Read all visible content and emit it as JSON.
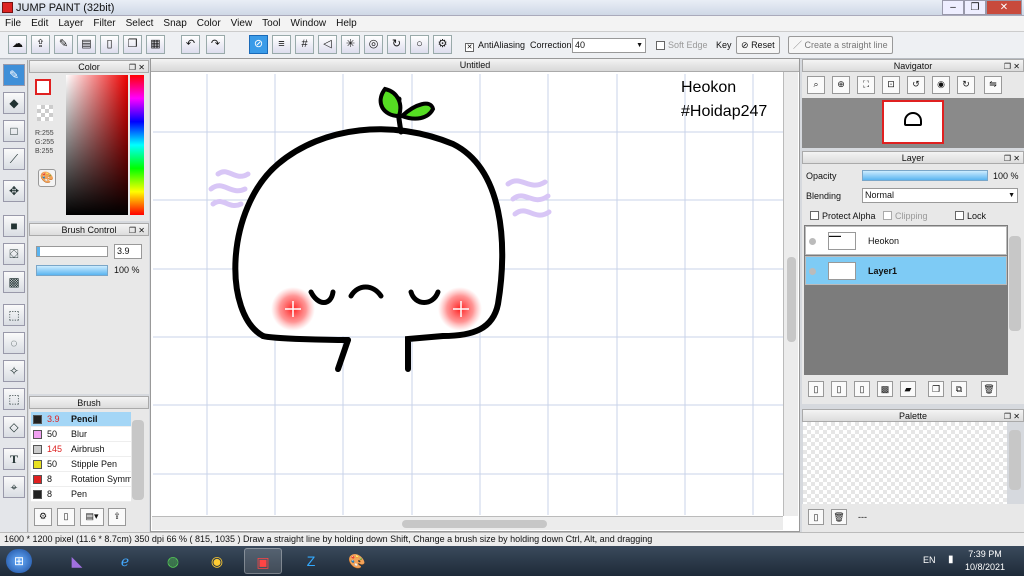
{
  "window": {
    "title": "JUMP PAINT (32bit)",
    "minimize": "–",
    "restore": "❐",
    "close": "✕"
  },
  "menu": [
    "File",
    "Edit",
    "Layer",
    "Filter",
    "Select",
    "Snap",
    "Color",
    "View",
    "Tool",
    "Window",
    "Help"
  ],
  "toolbar": {
    "antialiasing_label": "AntiAliasing",
    "correction_label": "Correction",
    "correction_value": "40",
    "soft_edge_label": "Soft Edge",
    "key_label": "Key",
    "reset_label": "Reset",
    "straight_line_label": "Create a straight line"
  },
  "color_panel": {
    "title": "Color",
    "r": "R:255",
    "g": "G:255",
    "b": "B:255",
    "fg_color": "#e02020"
  },
  "brush_control": {
    "title": "Brush Control",
    "size": "3.9",
    "opacity": "100 %"
  },
  "brush_panel": {
    "title": "Brush",
    "items": [
      {
        "size": "3.9",
        "name": "Pencil",
        "color": "#222222",
        "selected": true
      },
      {
        "size": "50",
        "name": "Blur",
        "color": "#f0a0f0"
      },
      {
        "size": "145",
        "name": "Airbrush",
        "color": "#cccccc"
      },
      {
        "size": "50",
        "name": "Stipple Pen",
        "color": "#e8e020"
      },
      {
        "size": "8",
        "name": "Rotation Symm",
        "color": "#e02020"
      },
      {
        "size": "8",
        "name": "Pen",
        "color": "#222222"
      }
    ]
  },
  "canvas": {
    "tab_title": "Untitled",
    "text_line1": "Heokon",
    "text_line2": "#Hoidap247"
  },
  "navigator": {
    "title": "Navigator"
  },
  "layer_panel": {
    "title": "Layer",
    "opacity_label": "Opacity",
    "opacity_value": "100 %",
    "opacity_level": 1.0,
    "blending_label": "Blending",
    "blending_value": "Normal",
    "protect_alpha": "Protect Alpha",
    "clipping": "Clipping",
    "lock": "Lock",
    "layers": [
      {
        "name": "Heokon",
        "selected": false
      },
      {
        "name": "Layer1",
        "selected": true
      }
    ]
  },
  "palette": {
    "title": "Palette",
    "extra": "---"
  },
  "status": {
    "text": "1600 * 1200 pixel   (11.6 * 8.7cm)   350 dpi   66 %   ( 815, 1035 )   Draw a straight line by holding down Shift, Change a brush size by holding down Ctrl, Alt, and dragging"
  },
  "taskbar": {
    "lang": "EN",
    "time": "7:39 PM",
    "date": "10/8/2021"
  }
}
